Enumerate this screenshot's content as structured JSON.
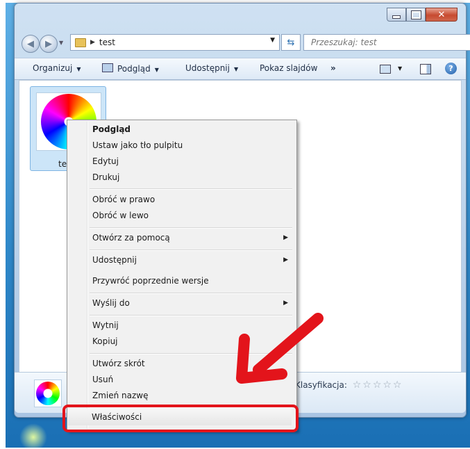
{
  "address": {
    "path": "test"
  },
  "search": {
    "placeholder": "Przeszukaj: test"
  },
  "toolbar": {
    "organize": "Organizuj",
    "preview": "Podgląd",
    "share": "Udostępnij",
    "slideshow": "Pokaz slajdów",
    "more": "»"
  },
  "file": {
    "name_visible": "te"
  },
  "details": {
    "rating_label": "Klasyfikacja:",
    "stars": "☆☆☆☆☆"
  },
  "context_menu": {
    "items": [
      "Podgląd",
      "Ustaw jako tło pulpitu",
      "Edytuj",
      "Drukuj",
      "Obróć w prawo",
      "Obróć w lewo",
      "Otwórz za pomocą",
      "Udostępnij",
      "Przywróć poprzednie wersje",
      "Wyślij do",
      "Wytnij",
      "Kopiuj",
      "Utwórz skrót",
      "Usuń",
      "Zmień nazwę",
      "Właściwości"
    ]
  },
  "colors": {
    "annotation": "#e3141b",
    "selection": "#cce5f8"
  },
  "icons": {
    "back": "back-arrow-icon",
    "forward": "forward-arrow-icon",
    "search": "search-icon",
    "help": "help-icon",
    "refresh": "refresh-icon"
  }
}
